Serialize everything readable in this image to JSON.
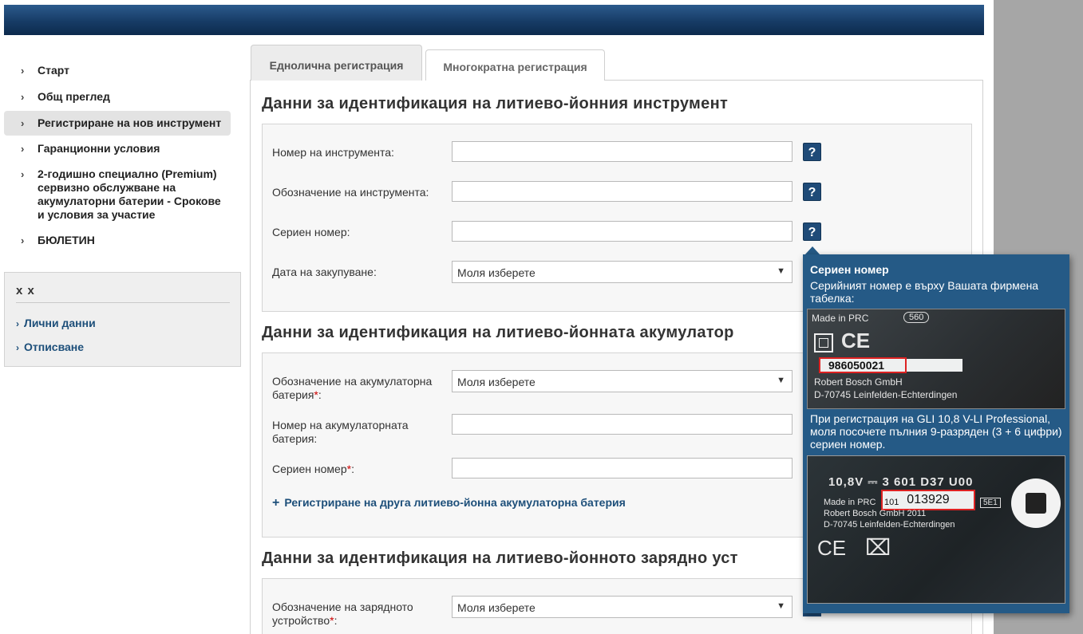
{
  "nav": {
    "items": [
      {
        "label": "Старт"
      },
      {
        "label": "Общ преглед"
      },
      {
        "label": "Регистриране на нов инструмент"
      },
      {
        "label": "Гаранционни условия"
      },
      {
        "label": "2-годишно специално (Premium) сервизно обслужване на акумулаторни батерии - Срокове и условия за участие"
      },
      {
        "label": "БЮЛЕТИН"
      }
    ]
  },
  "account": {
    "title": "x x",
    "links": [
      {
        "label": "Лични данни"
      },
      {
        "label": "Отписване"
      }
    ]
  },
  "tabs": [
    {
      "label": "Еднолична регистрация"
    },
    {
      "label": "Многократна регистрация"
    }
  ],
  "tool": {
    "heading": "Данни за идентификация на литиево-йонния инструмент",
    "number_label": "Номер на инструмента:",
    "designation_label": "Обозначение на инструмента:",
    "serial_label": "Сериен номер:",
    "date_label": "Дата на закупуване:",
    "date_value": "Моля изберете"
  },
  "battery": {
    "heading": "Данни за идентификация на литиево-йонната акумулатор",
    "designation_label": "Обозначение на акумулаторна батерия",
    "designation_value": "Моля изберете",
    "number_label": "Номер на акумулаторната батерия:",
    "serial_label": "Сериен номер",
    "add_label": "Регистриране на друга литиево-йонна акумулаторна батерия"
  },
  "charger": {
    "heading": "Данни за идентификация на литиево-йонното зарядно уст",
    "designation_label": "Обозначение на зарядното устройство",
    "designation_value": "Моля изберете"
  },
  "common": {
    "required_mark": "*",
    "colon": ":",
    "help_symbol": "?",
    "dropdown_arrow": "▼"
  },
  "tooltip": {
    "title": "Сериен номер",
    "text1": "Серийният номер е върху Вашата фирмена табелка:",
    "text2": "При регистрация на GLI 10,8 V-LI Professional, моля посочете пълния 9-разряден (3 + 6 цифри) сериен номер.",
    "plate1": {
      "made_in": "Made in PRC",
      "code": "560",
      "ce": "CE",
      "serial": "986050021",
      "company": "Robert Bosch GmbH",
      "address": "D-70745 Leinfelden-Echterdingen"
    },
    "plate2": {
      "model": "10,8V ⎓ 3 601 D37 U00",
      "made_in": "Made in PRC",
      "prefix": "101",
      "serial": "013929",
      "badge": "5E1",
      "company": "Robert Bosch GmbH  2011",
      "address": "D-70745 Leinfelden-Echterdingen",
      "ce": "CE",
      "weee": "⌧"
    }
  }
}
